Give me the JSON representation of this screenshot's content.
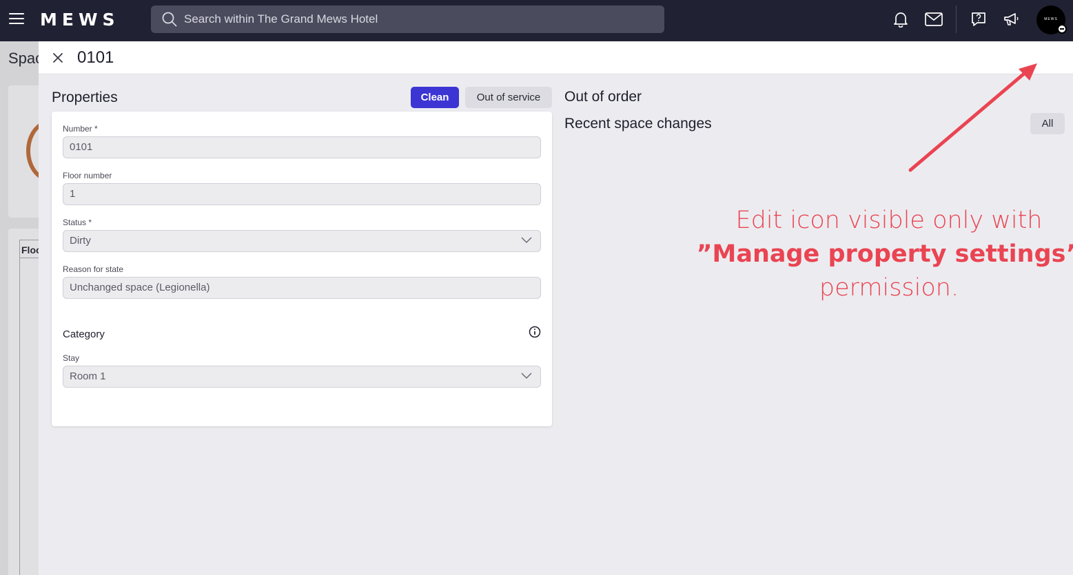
{
  "topbar": {
    "logo": "MEWS",
    "search_placeholder": "Search within The Grand Mews Hotel",
    "avatar_text": "MEWS"
  },
  "background_page": {
    "title": "Spac",
    "table_header": "Floo"
  },
  "drawer": {
    "title": "0101",
    "properties": {
      "heading": "Properties",
      "clean_label": "Clean",
      "out_of_service_label": "Out of service",
      "fields": {
        "number": {
          "label": "Number *",
          "value": "0101"
        },
        "floor": {
          "label": "Floor number",
          "value": "1"
        },
        "status": {
          "label": "Status *",
          "value": "Dirty"
        },
        "reason": {
          "label": "Reason for state",
          "value": "Unchanged space (Legionella)"
        }
      },
      "category": {
        "heading": "Category",
        "stay_label": "Stay",
        "stay_value": "Room 1"
      }
    },
    "out_of_order_heading": "Out of order",
    "recent_changes_heading": "Recent space changes",
    "all_label": "All"
  },
  "annotation": {
    "line1": "Edit icon visible only with",
    "line2": "”Manage property settings”",
    "line3": "permission.",
    "color": "#ea4452"
  },
  "colors": {
    "topbar": "#202132",
    "primary_button": "#3c35d4",
    "page_bg": "#ececf0"
  }
}
